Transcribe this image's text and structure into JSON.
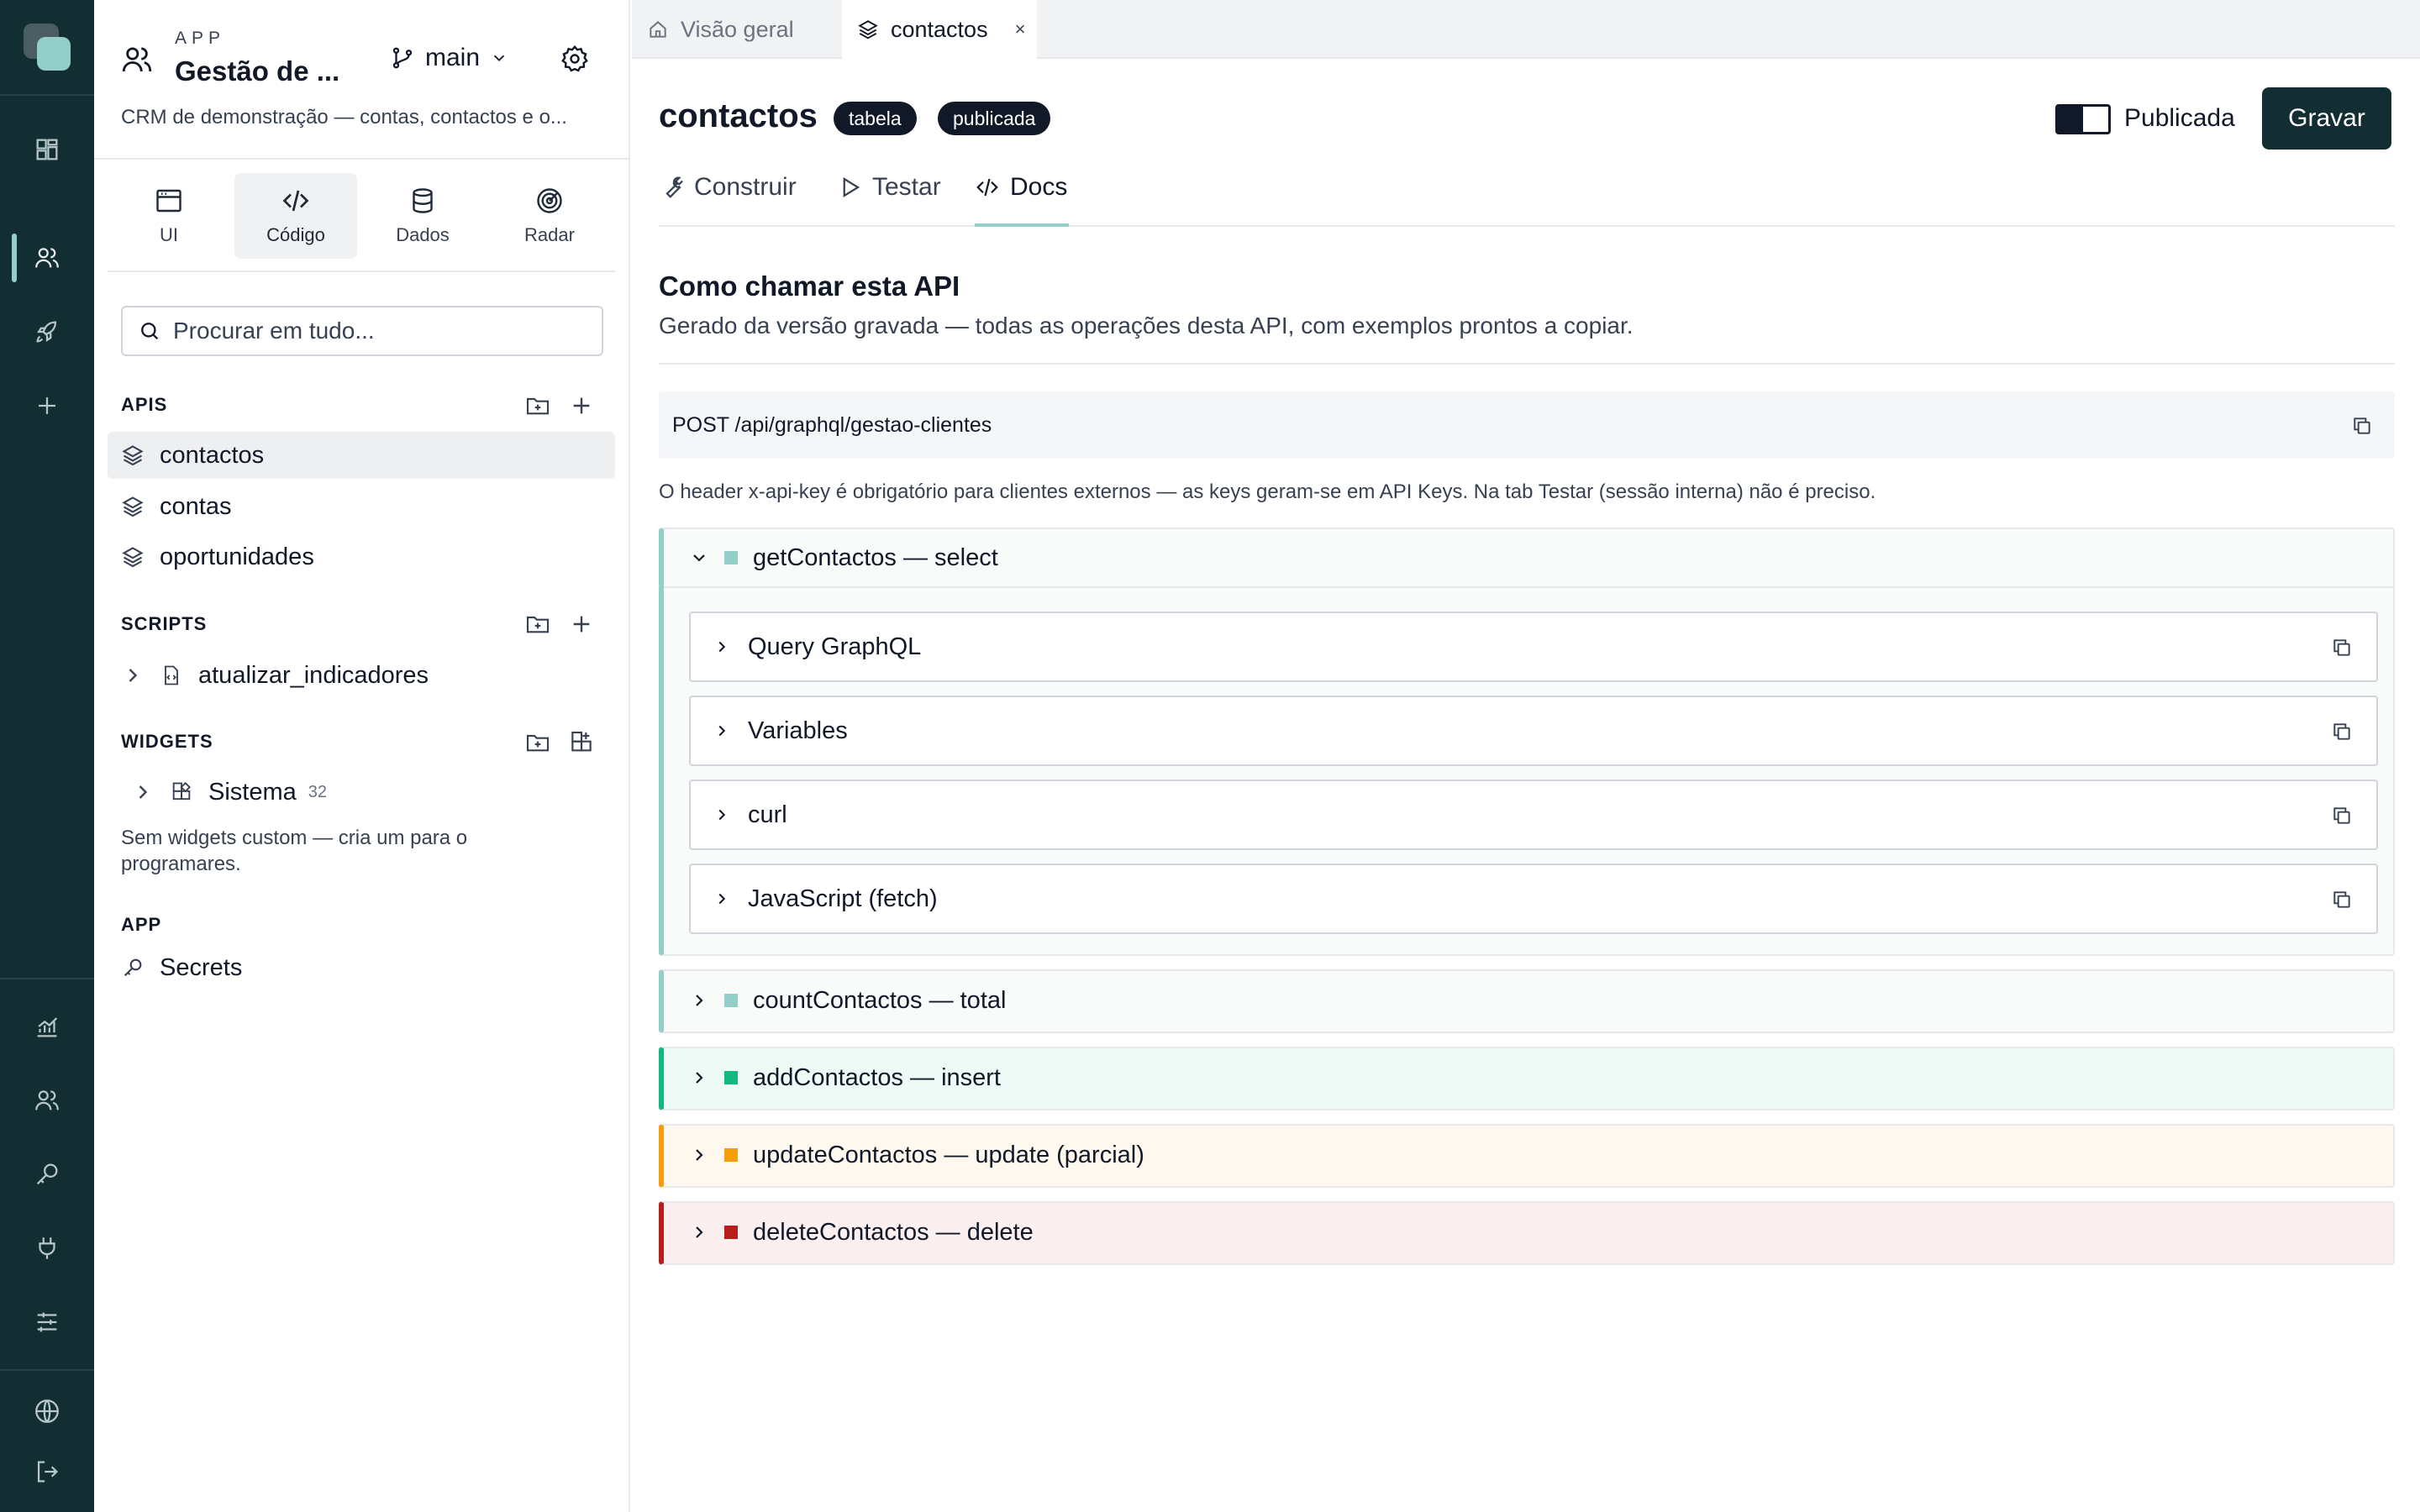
{
  "app": {
    "label": "APP",
    "name": "Gestão de ...",
    "branch": "main",
    "description": "CRM de demonstração — contas, contactos e o..."
  },
  "modes": [
    {
      "label": "UI",
      "icon": "window-icon"
    },
    {
      "label": "Código",
      "icon": "code-icon"
    },
    {
      "label": "Dados",
      "icon": "database-icon"
    },
    {
      "label": "Radar",
      "icon": "radar-icon"
    }
  ],
  "search": {
    "placeholder": "Procurar em tudo..."
  },
  "sections": {
    "apis": {
      "title": "APIS",
      "items": [
        "contactos",
        "contas",
        "oportunidades"
      ]
    },
    "scripts": {
      "title": "SCRIPTS",
      "items": [
        "atualizar_indicadores"
      ]
    },
    "widgets": {
      "title": "WIDGETS",
      "group": "Sistema",
      "count": "32",
      "note": "Sem widgets custom — cria um para o programares."
    },
    "app": {
      "title": "APP",
      "items": [
        "Secrets"
      ]
    }
  },
  "tabs": [
    {
      "label": "Visão geral",
      "icon": "home-icon"
    },
    {
      "label": "contactos",
      "icon": "layers-icon",
      "close": "×"
    }
  ],
  "header": {
    "title": "contactos",
    "badges": [
      "tabela",
      "publicada"
    ],
    "toggle_label": "Publicada",
    "save_label": "Gravar"
  },
  "subtabs": [
    "Construir",
    "Testar",
    "Docs"
  ],
  "docs": {
    "heading": "Como chamar esta API",
    "subtitle": "Gerado da versão gravada — todas as operações desta API, com exemplos prontos a copiar.",
    "endpoint": "POST /api/graphql/gestao-clientes",
    "hint": "O header x-api-key é obrigatório para clientes externos — as keys geram-se em API Keys. Na tab Testar (sessão interna) não é preciso.",
    "operations": [
      {
        "label": "getContactos — select",
        "expanded": true,
        "color": "#93cfc8",
        "bg": "#f9fafa"
      },
      {
        "label": "countContactos — total",
        "expanded": false,
        "color": "#93cfc8",
        "bg": "#f9fafa"
      },
      {
        "label": "addContactos — insert",
        "expanded": false,
        "color": "#10b981",
        "bg": "#eefaf5"
      },
      {
        "label": "updateContactos — update (parcial)",
        "expanded": false,
        "color": "#f59e0b",
        "bg": "#fff8ee"
      },
      {
        "label": "deleteContactos — delete",
        "expanded": false,
        "color": "#b91c1c",
        "bg": "#fbefef"
      }
    ],
    "subsections": [
      "Query GraphQL",
      "Variables",
      "curl",
      "JavaScript (fetch)"
    ]
  },
  "colors": {
    "rail": "#132e33",
    "accent": "#93cfc8",
    "dark": "#111827"
  }
}
